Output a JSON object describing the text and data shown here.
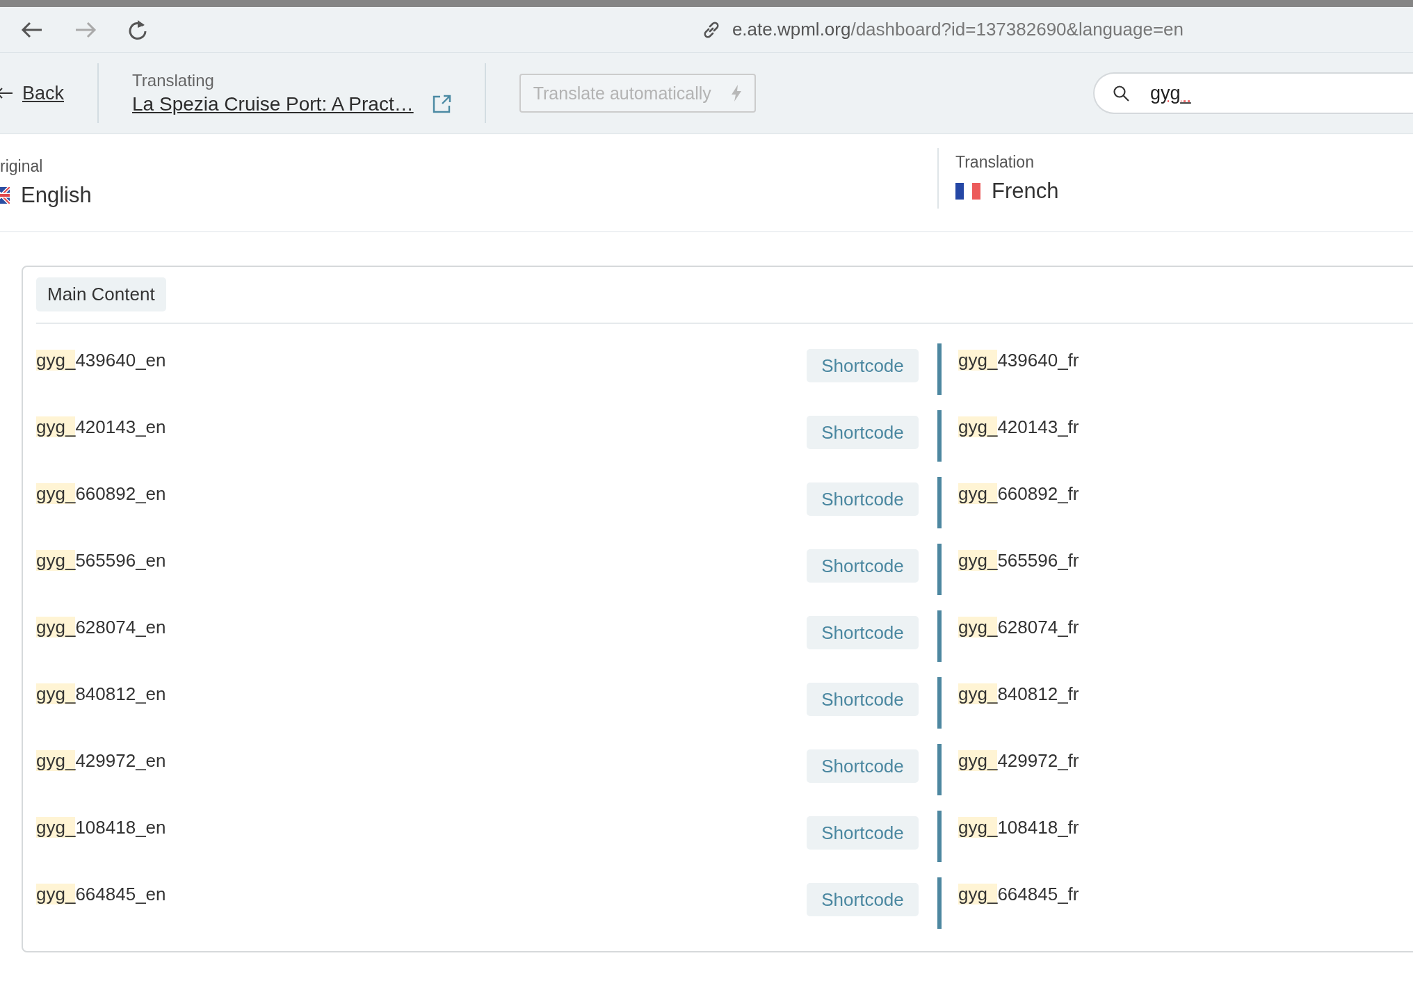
{
  "browser": {
    "url_host": "e.ate.wpml.org",
    "url_path": "/dashboard?id=137382690&language=en",
    "forward_disabled": true
  },
  "header": {
    "back": "Back",
    "translating_label": "Translating",
    "document_title": "La Spezia Cruise Port: A Pract…",
    "translate_button": {
      "label": "Translate automatically",
      "disabled": true
    },
    "search": {
      "value": "gyg_"
    }
  },
  "languages": {
    "original": {
      "label": "riginal",
      "name": "English"
    },
    "translation": {
      "label": "Translation",
      "name": "French"
    }
  },
  "section": {
    "title": "Main Content",
    "rows": [
      {
        "original": "gyg_439640_en",
        "type": "Shortcode",
        "translation": "gyg_439640_fr"
      },
      {
        "original": "gyg_420143_en",
        "type": "Shortcode",
        "translation": "gyg_420143_fr"
      },
      {
        "original": "gyg_660892_en",
        "type": "Shortcode",
        "translation": "gyg_660892_fr"
      },
      {
        "original": "gyg_565596_en",
        "type": "Shortcode",
        "translation": "gyg_565596_fr"
      },
      {
        "original": "gyg_628074_en",
        "type": "Shortcode",
        "translation": "gyg_628074_fr"
      },
      {
        "original": "gyg_840812_en",
        "type": "Shortcode",
        "translation": "gyg_840812_fr"
      },
      {
        "original": "gyg_429972_en",
        "type": "Shortcode",
        "translation": "gyg_429972_fr"
      },
      {
        "original": "gyg_108418_en",
        "type": "Shortcode",
        "translation": "gyg_108418_fr"
      },
      {
        "original": "gyg_664845_en",
        "type": "Shortcode",
        "translation": "gyg_664845_fr"
      }
    ]
  }
}
